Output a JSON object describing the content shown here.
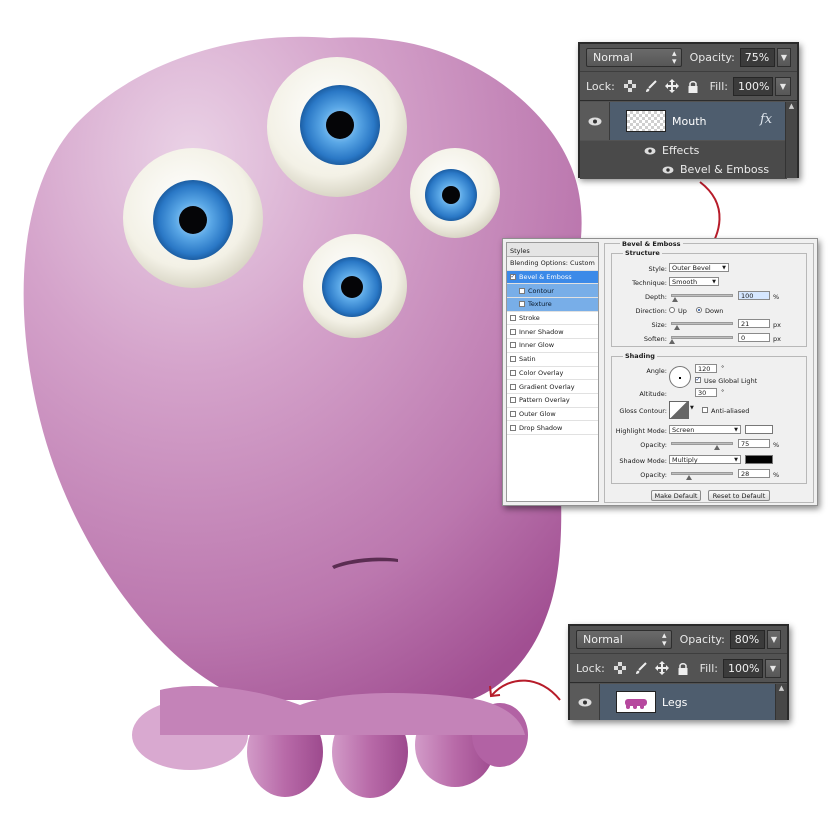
{
  "mouth_panel": {
    "blend_mode": "Normal",
    "opacity_label": "Opacity:",
    "opacity_value": "75%",
    "lock_label": "Lock:",
    "fill_label": "Fill:",
    "fill_value": "100%",
    "layer_name": "Mouth",
    "fx_label": "fx",
    "effects_label": "Effects",
    "effect_item": "Bevel & Emboss"
  },
  "legs_panel": {
    "blend_mode": "Normal",
    "opacity_label": "Opacity:",
    "opacity_value": "80%",
    "lock_label": "Lock:",
    "fill_label": "Fill:",
    "fill_value": "100%",
    "layer_name": "Legs"
  },
  "layer_style": {
    "styles_header": "Styles",
    "blending_options": "Blending Options: Custom",
    "styles_list": [
      {
        "label": "Bevel & Emboss",
        "checked": true,
        "selected": true
      },
      {
        "label": "Contour",
        "checked": false,
        "sub": true
      },
      {
        "label": "Texture",
        "checked": false,
        "sub": true
      },
      {
        "label": "Stroke",
        "checked": false
      },
      {
        "label": "Inner Shadow",
        "checked": false
      },
      {
        "label": "Inner Glow",
        "checked": false
      },
      {
        "label": "Satin",
        "checked": false
      },
      {
        "label": "Color Overlay",
        "checked": false
      },
      {
        "label": "Gradient Overlay",
        "checked": false
      },
      {
        "label": "Pattern Overlay",
        "checked": false
      },
      {
        "label": "Outer Glow",
        "checked": false
      },
      {
        "label": "Drop Shadow",
        "checked": false
      }
    ],
    "section_title": "Bevel & Emboss",
    "structure": {
      "title": "Structure",
      "style_label": "Style:",
      "style_value": "Outer Bevel",
      "technique_label": "Technique:",
      "technique_value": "Smooth",
      "depth_label": "Depth:",
      "depth_value": "100",
      "depth_unit": "%",
      "depth_level": 0.05,
      "direction_label": "Direction:",
      "direction_up": "Up",
      "direction_down": "Down",
      "direction_selected": "Down",
      "size_label": "Size:",
      "size_value": "21",
      "size_unit": "px",
      "size_level": 0.08,
      "soften_label": "Soften:",
      "soften_value": "0",
      "soften_unit": "px",
      "soften_level": 0.0
    },
    "shading": {
      "title": "Shading",
      "angle_label": "Angle:",
      "angle_value": "120",
      "angle_unit": "°",
      "use_global_light": "Use Global Light",
      "use_global_light_checked": true,
      "altitude_label": "Altitude:",
      "altitude_value": "30",
      "altitude_unit": "°",
      "gloss_contour_label": "Gloss Contour:",
      "anti_aliased": "Anti-aliased",
      "anti_aliased_checked": false,
      "highlight_mode_label": "Highlight Mode:",
      "highlight_mode": "Screen",
      "highlight_color": "#ffffff",
      "highlight_opacity_label": "Opacity:",
      "highlight_opacity": "75",
      "highlight_opacity_unit": "%",
      "highlight_opacity_level": 0.75,
      "shadow_mode_label": "Shadow Mode:",
      "shadow_mode": "Multiply",
      "shadow_color": "#000000",
      "shadow_opacity_label": "Opacity:",
      "shadow_opacity": "28",
      "shadow_opacity_unit": "%",
      "shadow_opacity_level": 0.28
    },
    "make_default": "Make Default",
    "reset_to_default": "Reset to Default"
  },
  "colors": {
    "monster_light": "#e3c2dc",
    "monster_mid": "#c78cbf",
    "monster_dark": "#a14f92",
    "iris": "#3f8fd9",
    "arrow": "#b71c2a"
  }
}
